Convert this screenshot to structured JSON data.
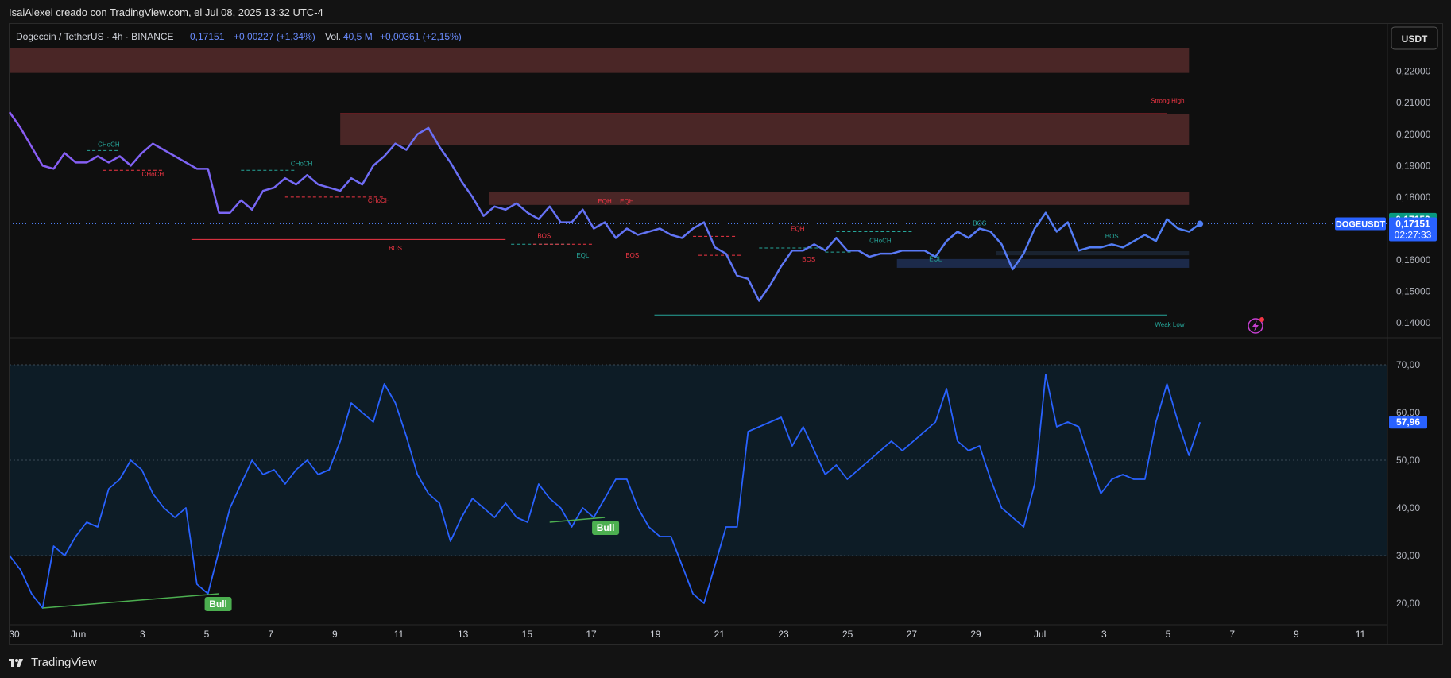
{
  "caption": "IsaiAlexei creado con TradingView.com, el Jul 08, 2025 13:32 UTC-4",
  "logo_text": "TradingView",
  "header": {
    "symbol": "Dogecoin / TetherUS · 4h · BINANCE",
    "price": "0,17151",
    "change": "+0,00227 (+1,34%)",
    "vol_label": "Vol.",
    "vol_value": "40,5 M",
    "vol_change": "+0,00361 (+2,15%)"
  },
  "currency_button": "USDT",
  "colors": {
    "price_line": "#4f7ff5",
    "price_line_start": "#8c5cf5",
    "rsi_line": "#2962ff",
    "bull": "#4caf50",
    "bear": "#f23645",
    "zone_red": "#4a2626",
    "zone_blue": "#1c2a4a",
    "rsi_band": "#0d1c26"
  },
  "price_axis": {
    "ticks": [
      "0,22000",
      "0,21000",
      "0,20000",
      "0,19000",
      "0,18000",
      "0,17000",
      "0,16000",
      "0,15000",
      "0,14000"
    ],
    "tick_values": [
      0.22,
      0.21,
      0.2,
      0.19,
      0.18,
      0.17,
      0.16,
      0.15,
      0.14
    ],
    "last_price_label": "0,17152",
    "symbol_label": "DOGEUSDT",
    "symbol_price": "0,17151",
    "countdown": "02:27:33"
  },
  "rsi_axis": {
    "ticks": [
      "70,00",
      "60,00",
      "50,00",
      "40,00",
      "30,00",
      "20,00"
    ],
    "tick_values": [
      70,
      60,
      50,
      40,
      30,
      20
    ],
    "current_label": "57,96"
  },
  "time_axis": {
    "labels": [
      "30",
      "Jun",
      "3",
      "5",
      "7",
      "9",
      "11",
      "13",
      "15",
      "17",
      "19",
      "21",
      "23",
      "25",
      "27",
      "29",
      "Jul",
      "3",
      "5",
      "7",
      "9",
      "11"
    ]
  },
  "chart_data": [
    {
      "type": "line",
      "title": "Dogecoin / TetherUS · 4h · BINANCE",
      "x": [
        0,
        2,
        4,
        6,
        8,
        10,
        12,
        14,
        16,
        18,
        20,
        22,
        24,
        26,
        28,
        30,
        32,
        34,
        36,
        38,
        40,
        42,
        44,
        46,
        48,
        50,
        52,
        54,
        56,
        58,
        60,
        62,
        64,
        66,
        68,
        70,
        72,
        74,
        76,
        78,
        80,
        82,
        84,
        86,
        88,
        90,
        92,
        94,
        96,
        98,
        100,
        102,
        104,
        106,
        108,
        110,
        112,
        114,
        116,
        118,
        120,
        122,
        124,
        126,
        128,
        130,
        132,
        134,
        136,
        138,
        140,
        142,
        144,
        146,
        148,
        150,
        152,
        154,
        156,
        158,
        160,
        162,
        164,
        166,
        168,
        170,
        172,
        174,
        176,
        178,
        180,
        182,
        184,
        186,
        188,
        190,
        192,
        194,
        196,
        198,
        200,
        202,
        204,
        206,
        208,
        210,
        212,
        214,
        216
      ],
      "values": [
        0.207,
        0.202,
        0.196,
        0.19,
        0.189,
        0.194,
        0.191,
        0.191,
        0.193,
        0.191,
        0.193,
        0.19,
        0.194,
        0.197,
        0.195,
        0.193,
        0.191,
        0.189,
        0.189,
        0.175,
        0.175,
        0.179,
        0.176,
        0.182,
        0.183,
        0.186,
        0.184,
        0.187,
        0.184,
        0.183,
        0.182,
        0.186,
        0.184,
        0.19,
        0.193,
        0.197,
        0.195,
        0.2,
        0.202,
        0.196,
        0.191,
        0.185,
        0.18,
        0.174,
        0.177,
        0.176,
        0.178,
        0.175,
        0.173,
        0.177,
        0.172,
        0.172,
        0.176,
        0.17,
        0.172,
        0.167,
        0.17,
        0.168,
        0.169,
        0.17,
        0.168,
        0.167,
        0.17,
        0.172,
        0.164,
        0.162,
        0.155,
        0.154,
        0.147,
        0.152,
        0.158,
        0.163,
        0.163,
        0.165,
        0.163,
        0.167,
        0.163,
        0.163,
        0.161,
        0.162,
        0.162,
        0.163,
        0.163,
        0.163,
        0.161,
        0.166,
        0.169,
        0.167,
        0.17,
        0.169,
        0.165,
        0.157,
        0.162,
        0.17,
        0.175,
        0.169,
        0.172,
        0.163,
        0.164,
        0.164,
        0.165,
        0.164,
        0.166,
        0.168,
        0.166,
        0.173,
        0.17,
        0.169,
        0.17151
      ],
      "ylim": [
        0.1355,
        0.2275
      ]
    },
    {
      "type": "line",
      "title": "RSI",
      "x": [
        0,
        2,
        4,
        6,
        8,
        10,
        12,
        14,
        16,
        18,
        20,
        22,
        24,
        26,
        28,
        30,
        32,
        34,
        36,
        38,
        40,
        42,
        44,
        46,
        48,
        50,
        52,
        54,
        56,
        58,
        60,
        62,
        64,
        66,
        68,
        70,
        72,
        74,
        76,
        78,
        80,
        82,
        84,
        86,
        88,
        90,
        92,
        94,
        96,
        98,
        100,
        102,
        104,
        106,
        108,
        110,
        112,
        114,
        116,
        118,
        120,
        122,
        124,
        126,
        128,
        130,
        132,
        134,
        136,
        138,
        140,
        142,
        144,
        146,
        148,
        150,
        152,
        154,
        156,
        158,
        160,
        162,
        164,
        166,
        168,
        170,
        172,
        174,
        176,
        178,
        180,
        182,
        184,
        186,
        188,
        190,
        192,
        194,
        196,
        198,
        200,
        202,
        204,
        206,
        208,
        210,
        212,
        214,
        216
      ],
      "values": [
        30,
        27,
        22,
        19,
        32,
        30,
        34,
        37,
        36,
        44,
        46,
        50,
        48,
        43,
        40,
        38,
        40,
        24,
        22,
        31,
        40,
        45,
        50,
        47,
        48,
        45,
        48,
        50,
        47,
        48,
        54,
        62,
        60,
        58,
        66,
        62,
        55,
        47,
        43,
        41,
        33,
        38,
        42,
        40,
        38,
        41,
        38,
        37,
        45,
        42,
        40,
        36,
        40,
        38,
        42,
        46,
        46,
        40,
        36,
        34,
        34,
        28,
        22,
        20,
        28,
        36,
        36,
        56,
        57,
        58,
        59,
        53,
        57,
        52,
        47,
        49,
        46,
        48,
        50,
        52,
        54,
        52,
        54,
        56,
        58,
        65,
        54,
        52,
        53,
        46,
        40,
        38,
        36,
        45,
        68,
        57,
        58,
        57,
        50,
        43,
        46,
        47,
        46,
        46,
        58,
        66,
        58,
        51,
        57.96
      ],
      "ylim": [
        15.5,
        75.5
      ]
    }
  ],
  "annotations": {
    "choch": "CHoCH",
    "bos": "BOS",
    "eqh": "EQH",
    "eql": "EQL",
    "strong_high": "Strong High",
    "weak_low": "Weak Low",
    "bull": "Bull"
  }
}
